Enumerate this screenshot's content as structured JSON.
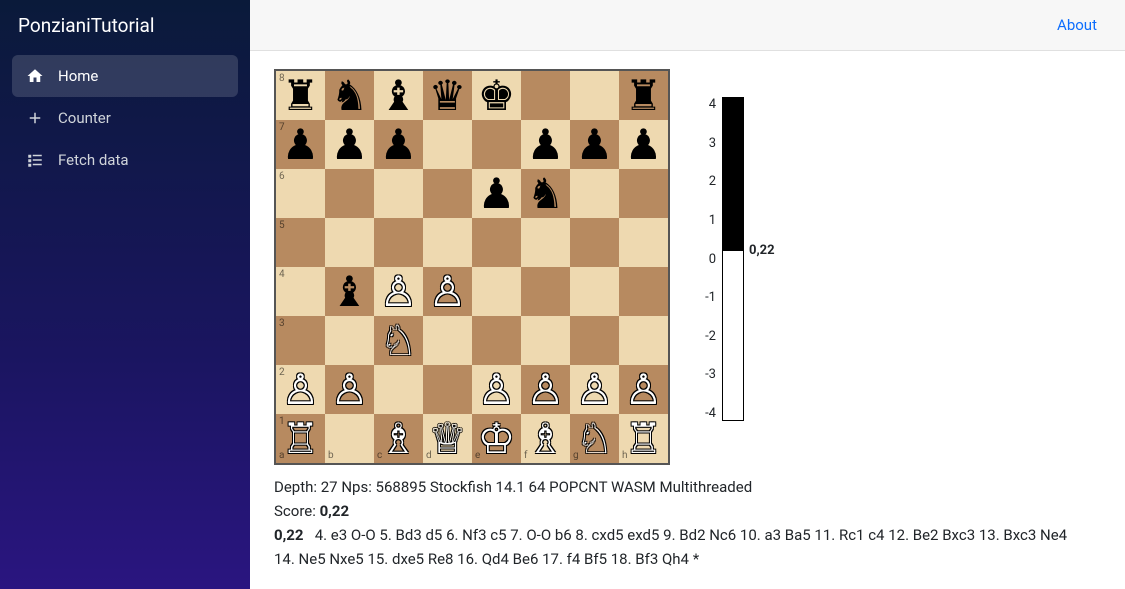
{
  "brand": "PonzianiTutorial",
  "sidebar": {
    "items": [
      {
        "icon": "home",
        "label": "Home",
        "active": true
      },
      {
        "icon": "plus",
        "label": "Counter",
        "active": false
      },
      {
        "icon": "list",
        "label": "Fetch data",
        "active": false
      }
    ]
  },
  "topbar": {
    "links": [
      {
        "label": "About"
      }
    ]
  },
  "board": {
    "position": [
      [
        "r",
        "n",
        "b",
        "q",
        "k",
        "",
        "",
        "r"
      ],
      [
        "p",
        "p",
        "p",
        "",
        "",
        "p",
        "p",
        "p"
      ],
      [
        "",
        "",
        "",
        "",
        "p",
        "n",
        "",
        ""
      ],
      [
        "",
        "",
        "",
        "",
        "",
        "",
        "",
        ""
      ],
      [
        "",
        "b",
        "P",
        "P",
        "",
        "",
        "",
        ""
      ],
      [
        "",
        "",
        "N",
        "",
        "",
        "",
        "",
        ""
      ],
      [
        "P",
        "P",
        "",
        "",
        "P",
        "P",
        "P",
        "P"
      ],
      [
        "R",
        "",
        "B",
        "Q",
        "K",
        "B",
        "N",
        "R"
      ]
    ],
    "ranks": [
      "8",
      "7",
      "6",
      "5",
      "4",
      "3",
      "2",
      "1"
    ],
    "files": [
      "a",
      "b",
      "c",
      "d",
      "e",
      "f",
      "g",
      "h"
    ]
  },
  "eval": {
    "ticks": [
      "4",
      "3",
      "2",
      "1",
      "0",
      "-1",
      "-2",
      "-3",
      "-4"
    ],
    "min": -4,
    "max": 4,
    "score": 0.22,
    "score_text": "0,22"
  },
  "engine": {
    "depth_line": "Depth: 27 Nps: 568895 Stockfish 14.1 64 POPCNT WASM Multithreaded",
    "score_prefix": "Score: ",
    "score_value": "0,22",
    "pv_score": "0,22",
    "pv_moves": "4. e3 O-O 5. Bd3 d5 6. Nf3 c5 7. O-O b6 8. cxd5 exd5 9. Bd2 Nc6 10. a3 Ba5 11. Rc1 c4 12. Be2 Bxc3 13. Bxc3 Ne4 14. Ne5 Nxe5 15. dxe5 Re8 16. Qd4 Be6 17. f4 Bf5 18. Bf3 Qh4 *"
  }
}
